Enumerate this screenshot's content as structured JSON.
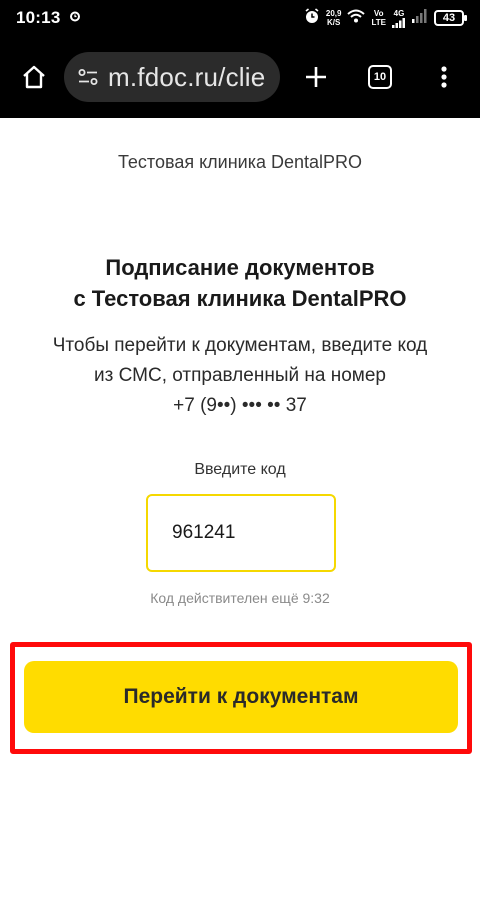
{
  "status_bar": {
    "time": "10:13",
    "speed_value": "20,9",
    "speed_unit": "K/S",
    "network_top": "Vo",
    "network_bottom": "LTE",
    "network_type": "4G",
    "battery": "43"
  },
  "browser": {
    "url": "m.fdoc.ru/clie",
    "tab_count": "10"
  },
  "page": {
    "clinic_name": "Тестовая клиника DentalPRO",
    "title_line1": "Подписание документов",
    "title_line2": "с Тестовая клиника DentalPRO",
    "description_line1": "Чтобы перейти к документам, введите код",
    "description_line2": "из СМС, отправленный на номер",
    "phone_masked": "+7 (9••) ••• •• 37",
    "code_label": "Введите код",
    "code_value": "961241",
    "validity_text": "Код действителен ещё 9:32",
    "submit_label": "Перейти к документам"
  },
  "colors": {
    "accent_yellow": "#ffdc00",
    "input_border": "#f5d800",
    "highlight_red": "#ff0a0a"
  }
}
